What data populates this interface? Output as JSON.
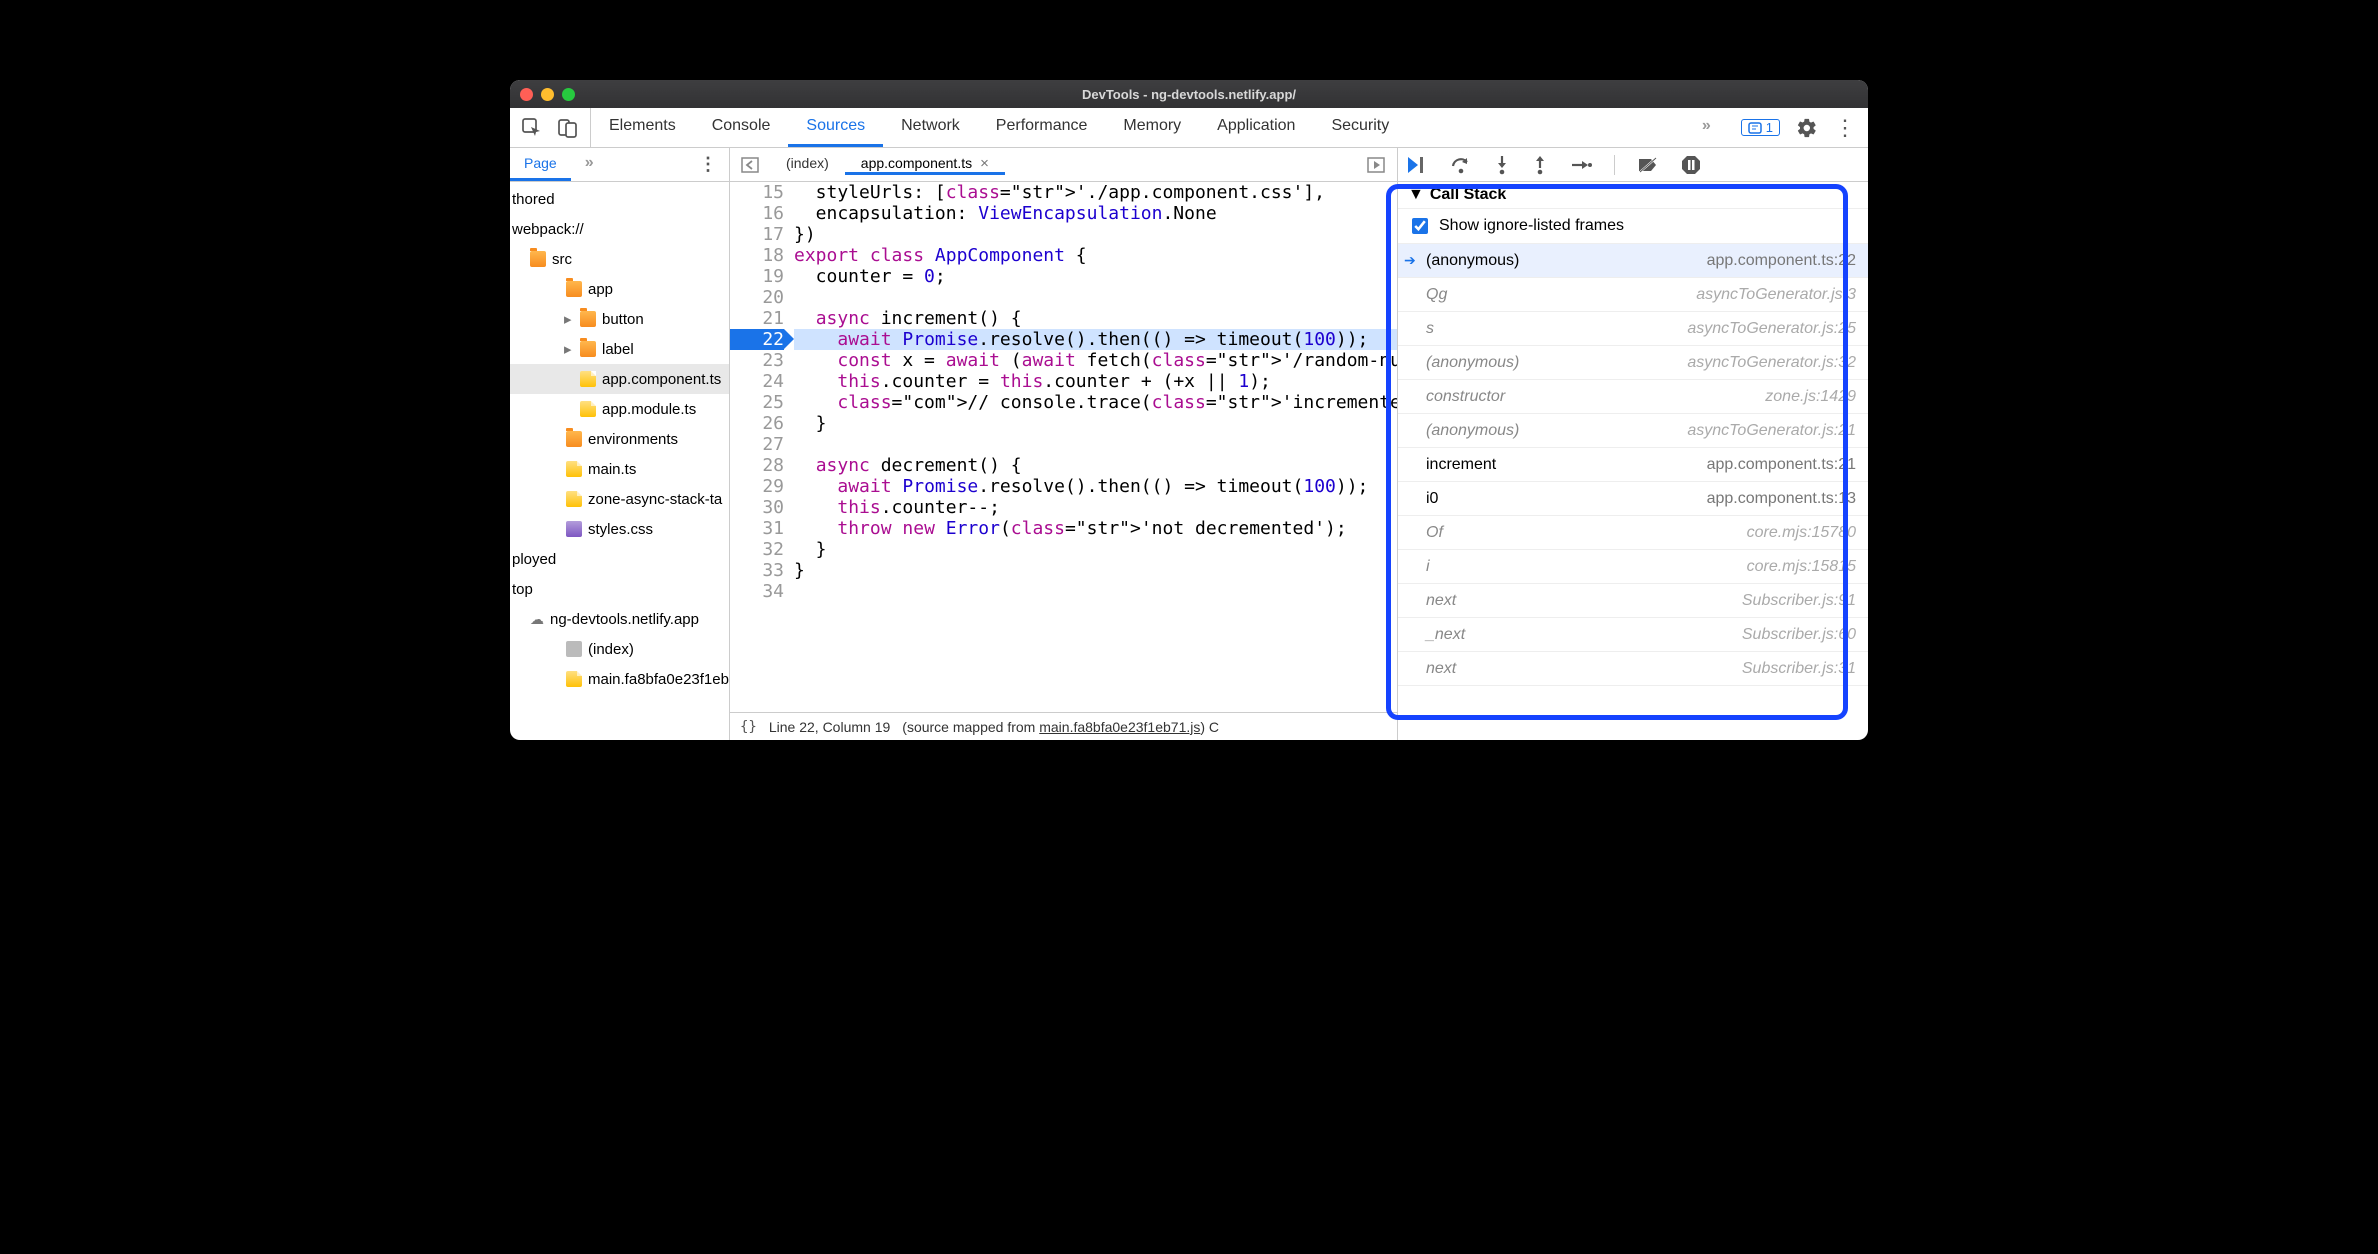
{
  "window": {
    "title": "DevTools - ng-devtools.netlify.app/"
  },
  "panels": {
    "tabs": [
      "Elements",
      "Console",
      "Sources",
      "Network",
      "Performance",
      "Memory",
      "Application",
      "Security"
    ],
    "active": "Sources",
    "issueCount": "1"
  },
  "navigator": {
    "primaryTab": "Page",
    "tree": [
      {
        "depth": 0,
        "icon": "",
        "label": "thored"
      },
      {
        "depth": 0,
        "icon": "",
        "label": "webpack://"
      },
      {
        "depth": 1,
        "icon": "folder",
        "label": "src"
      },
      {
        "depth": 2,
        "icon": "folder",
        "label": "app"
      },
      {
        "depth": 3,
        "icon": "folder",
        "label": "button",
        "expandable": true
      },
      {
        "depth": 3,
        "icon": "folder",
        "label": "label",
        "expandable": true
      },
      {
        "depth": 3,
        "icon": "file-y",
        "label": "app.component.ts",
        "selected": true
      },
      {
        "depth": 3,
        "icon": "file-y",
        "label": "app.module.ts"
      },
      {
        "depth": 2,
        "icon": "folder",
        "label": "environments"
      },
      {
        "depth": 2,
        "icon": "file-y",
        "label": "main.ts"
      },
      {
        "depth": 2,
        "icon": "file-y",
        "label": "zone-async-stack-ta"
      },
      {
        "depth": 2,
        "icon": "file-p",
        "label": "styles.css"
      },
      {
        "depth": 0,
        "icon": "",
        "label": "ployed"
      },
      {
        "depth": 0,
        "icon": "",
        "label": "top"
      },
      {
        "depth": 1,
        "icon": "cloud",
        "label": "ng-devtools.netlify.app"
      },
      {
        "depth": 2,
        "icon": "file-g",
        "label": "(index)"
      },
      {
        "depth": 2,
        "icon": "file-y",
        "label": "main.fa8bfa0e23f1eb"
      }
    ]
  },
  "editor": {
    "tabs": [
      {
        "label": "(index)",
        "active": false
      },
      {
        "label": "app.component.ts",
        "active": true,
        "closeable": true
      }
    ],
    "firstLine": 15,
    "activeLine": 22,
    "lines": [
      "  styleUrls: ['./app.component.css'],",
      "  encapsulation: ViewEncapsulation.None",
      "})",
      "export class AppComponent {",
      "  counter = 0;",
      "",
      "  async increment() {",
      "    await Promise.resolve().then(() => timeout(100));",
      "    const x = await (await fetch('/random-number')).text(",
      "    this.counter = this.counter + (+x || 1);",
      "    // console.trace('incremented');",
      "  }",
      "",
      "  async decrement() {",
      "    await Promise.resolve().then(() => timeout(100));",
      "    this.counter--;",
      "    throw new Error('not decremented');",
      "  }",
      "}",
      ""
    ],
    "status": {
      "pos": "Line 22, Column 19",
      "mappedLabel": "(source mapped from",
      "mappedFile": "main.fa8bfa0e23f1eb71.js",
      "trailing": ") C"
    }
  },
  "debugger": {
    "callStack": {
      "title": "Call Stack",
      "showIgnoreLabel": "Show ignore-listed frames",
      "frames": [
        {
          "name": "(anonymous)",
          "loc": "app.component.ts:22",
          "selected": true,
          "muted": false
        },
        {
          "name": "Qg",
          "loc": "asyncToGenerator.js:3",
          "muted": true
        },
        {
          "name": "s",
          "loc": "asyncToGenerator.js:25",
          "muted": true
        },
        {
          "name": "(anonymous)",
          "loc": "asyncToGenerator.js:32",
          "muted": true
        },
        {
          "name": "constructor",
          "loc": "zone.js:1429",
          "muted": true
        },
        {
          "name": "(anonymous)",
          "loc": "asyncToGenerator.js:21",
          "muted": true
        },
        {
          "name": "increment",
          "loc": "app.component.ts:21",
          "muted": false
        },
        {
          "name": "i0",
          "loc": "app.component.ts:13",
          "muted": false
        },
        {
          "name": "Of",
          "loc": "core.mjs:15780",
          "muted": true
        },
        {
          "name": "i",
          "loc": "core.mjs:15815",
          "muted": true
        },
        {
          "name": "next",
          "loc": "Subscriber.js:91",
          "muted": true
        },
        {
          "name": "_next",
          "loc": "Subscriber.js:60",
          "muted": true
        },
        {
          "name": "next",
          "loc": "Subscriber.js:31",
          "muted": true
        }
      ]
    }
  }
}
